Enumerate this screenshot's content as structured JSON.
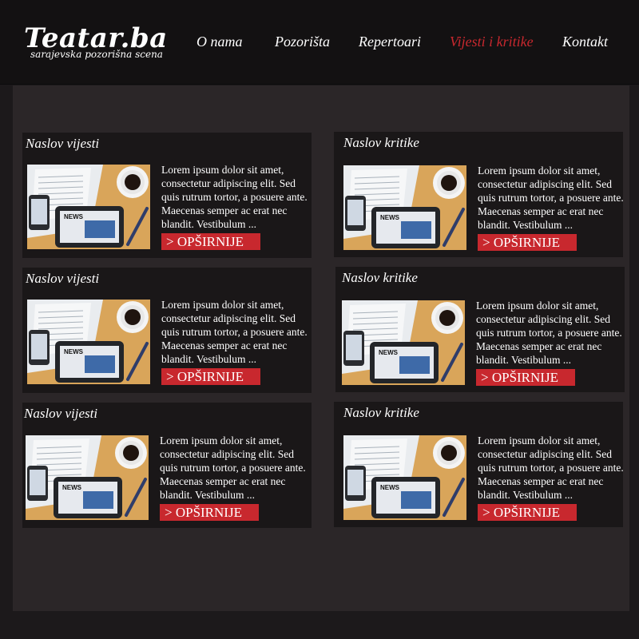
{
  "header": {
    "logo_title": "Teatar.ba",
    "logo_tagline": "sarajevska pozorišna scena"
  },
  "nav": {
    "items": [
      {
        "label": "O nama",
        "active": false
      },
      {
        "label": "Pozorišta",
        "active": false
      },
      {
        "label": "Repertoari",
        "active": false
      },
      {
        "label": "Vijesti i kritike",
        "active": true
      },
      {
        "label": "Kontakt",
        "active": false
      }
    ]
  },
  "cards": [
    {
      "title": "Naslov vijesti",
      "text": "Lorem ipsum dolor sit amet, consectetur adipiscing elit. Sed quis rutrum tortor, a posuere ante. Maecenas semper ac erat nec blandit. Vestibulum ...",
      "button": "> OPŠIRNIJE"
    },
    {
      "title": "Naslov kritike",
      "text": "Lorem ipsum dolor sit amet, consectetur adipiscing elit. Sed quis rutrum tortor, a posuere ante. Maecenas semper ac erat nec blandit. Vestibulum ...",
      "button": "> OPŠIRNIJE"
    },
    {
      "title": "Naslov vijesti",
      "text": "Lorem ipsum dolor sit amet, consectetur adipiscing elit. Sed quis rutrum tortor, a posuere ante. Maecenas semper ac erat nec blandit. Vestibulum ...",
      "button": "> OPŠIRNIJE"
    },
    {
      "title": "Naslov kritike",
      "text": "Lorem ipsum dolor sit amet, consectetur adipiscing elit. Sed quis rutrum tortor, a posuere ante. Maecenas semper ac erat nec blandit. Vestibulum ...",
      "button": "> OPŠIRNIJE"
    },
    {
      "title": "Naslov vijesti",
      "text": "Lorem ipsum dolor sit amet, consectetur adipiscing elit. Sed quis rutrum tortor, a posuere ante. Maecenas semper ac erat nec blandit. Vestibulum ...",
      "button": "> OPŠIRNIJE"
    },
    {
      "title": "Naslov kritike",
      "text": "Lorem ipsum dolor sit amet, consectetur adipiscing elit. Sed quis rutrum tortor, a posuere ante. Maecenas semper ac erat nec blandit. Vestibulum ...",
      "button": "> OPŠIRNIJE"
    }
  ],
  "thumbnail": {
    "icon": "news-thumbnail-icon",
    "caption": "NEWS"
  },
  "colors": {
    "accent": "#c8282e",
    "header_bg": "#131112",
    "content_bg": "#2b2628",
    "card_bg": "#1a1718",
    "text": "#ffffff"
  }
}
